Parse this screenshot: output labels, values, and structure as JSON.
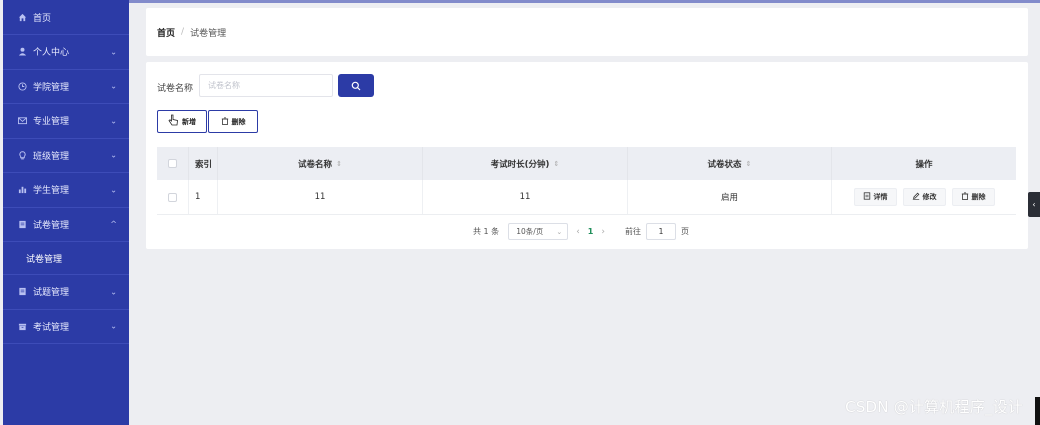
{
  "sidebar": {
    "items": [
      {
        "label": "首页",
        "icon": "home-icon"
      },
      {
        "label": "个人中心",
        "icon": "user-icon"
      },
      {
        "label": "学院管理",
        "icon": "clock-icon"
      },
      {
        "label": "专业管理",
        "icon": "mail-icon"
      },
      {
        "label": "班级管理",
        "icon": "bulb-icon"
      },
      {
        "label": "学生管理",
        "icon": "chart-icon"
      },
      {
        "label": "试卷管理",
        "icon": "doc-icon"
      },
      {
        "label": "试卷管理"
      },
      {
        "label": "试题管理",
        "icon": "doc-icon"
      },
      {
        "label": "考试管理",
        "icon": "archive-icon"
      }
    ]
  },
  "breadcrumb": {
    "home": "首页",
    "separator": "/",
    "current": "试卷管理"
  },
  "search": {
    "label": "试卷名称",
    "placeholder": "试卷名称",
    "value": ""
  },
  "toolbar": {
    "add_label": "新增",
    "delete_label": "删除"
  },
  "table": {
    "headers": {
      "index": "索引",
      "name": "试卷名称",
      "duration": "考试时长(分钟)",
      "status": "试卷状态",
      "ops": "操作"
    },
    "rows": [
      {
        "index": "1",
        "name": "11",
        "duration": "11",
        "status": "启用"
      }
    ],
    "ops": {
      "detail": "详情",
      "edit": "修改",
      "delete": "删除"
    }
  },
  "pagination": {
    "total": "共 1 条",
    "page_size": "10条/页",
    "current_page": "1",
    "goto_label": "前往",
    "goto_value": "1",
    "page_suffix": "页"
  },
  "watermark": "CSDN @计算机程序_设计",
  "colors": {
    "accent": "#2c3ba6",
    "background": "#edeef2"
  }
}
